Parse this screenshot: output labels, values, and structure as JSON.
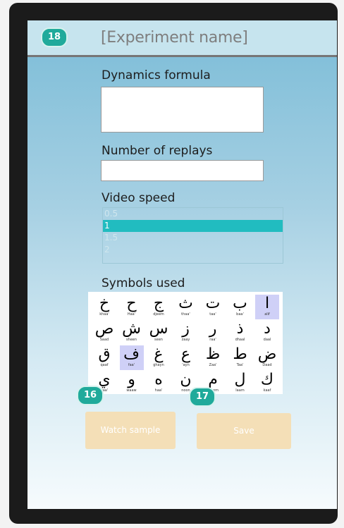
{
  "header": {
    "badge": "18",
    "experiment_name": "[Experiment name]"
  },
  "form": {
    "dynamics_label": "Dynamics formula",
    "replays_label": "Number of replays",
    "speed_label": "Video speed",
    "speed_options": [
      "0.5",
      "1",
      "1.5",
      "2"
    ],
    "speed_selected": "1",
    "symbols_label": "Symbols used"
  },
  "symbols": {
    "rows": [
      [
        {
          "g": "خ",
          "n": "khaa'"
        },
        {
          "g": "ح",
          "n": "Haa'"
        },
        {
          "g": "ج",
          "n": "djeem"
        },
        {
          "g": "ث",
          "n": "thaa'"
        },
        {
          "g": "ت",
          "n": "taa'"
        },
        {
          "g": "ب",
          "n": "baa'"
        },
        {
          "g": "ا",
          "n": "alif",
          "hl": true
        }
      ],
      [
        {
          "g": "ص",
          "n": "Saad"
        },
        {
          "g": "ش",
          "n": "sheen"
        },
        {
          "g": "س",
          "n": "seen"
        },
        {
          "g": "ز",
          "n": "zaay"
        },
        {
          "g": "ر",
          "n": "raa'"
        },
        {
          "g": "ذ",
          "n": "dhaal"
        },
        {
          "g": "د",
          "n": "daal"
        }
      ],
      [
        {
          "g": "ق",
          "n": "qaaf"
        },
        {
          "g": "ف",
          "n": "faa'",
          "hl": true
        },
        {
          "g": "غ",
          "n": "ghayn"
        },
        {
          "g": "ع",
          "n": "'ayn"
        },
        {
          "g": "ظ",
          "n": "Zaa'"
        },
        {
          "g": "ط",
          "n": "Taa'"
        },
        {
          "g": "ض",
          "n": "Daad"
        }
      ],
      [
        {
          "g": "ي",
          "n": "yaa'"
        },
        {
          "g": "و",
          "n": "waaw"
        },
        {
          "g": "ه",
          "n": "haa'"
        },
        {
          "g": "ن",
          "n": "noon"
        },
        {
          "g": "م",
          "n": "meem"
        },
        {
          "g": "ل",
          "n": "laam"
        },
        {
          "g": "ك",
          "n": "kaaf"
        }
      ]
    ]
  },
  "badges": {
    "left": "16",
    "right": "17"
  },
  "buttons": {
    "watch_sample": "Watch sample",
    "save": "Save"
  },
  "colors": {
    "accent": "#21bcc0",
    "badge": "#20aa9b",
    "button": "#f4dfb7",
    "highlight": "#cfd0f7"
  }
}
